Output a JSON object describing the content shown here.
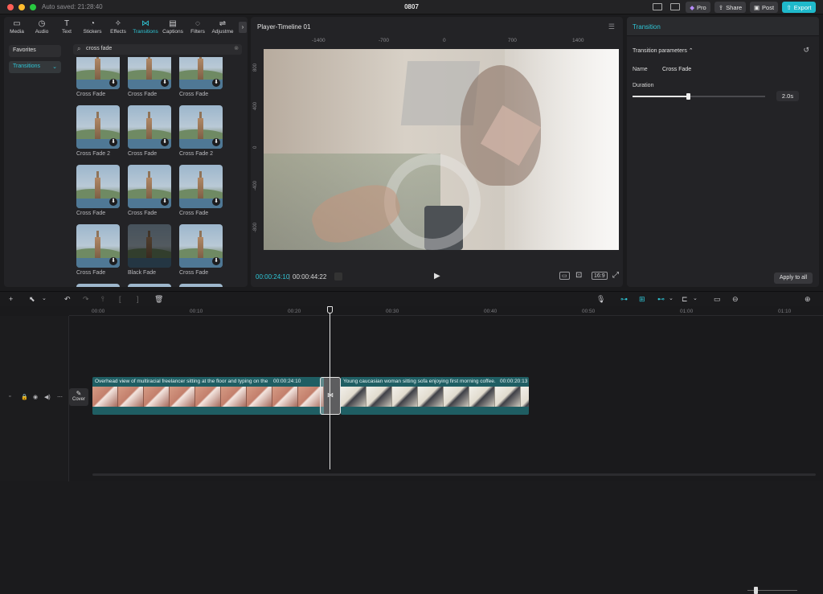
{
  "window": {
    "autosave": "Auto saved: 21:28:40",
    "title": "0807"
  },
  "topbar": {
    "pro": "Pro",
    "share": "Share",
    "post": "Post",
    "export": "Export"
  },
  "tabs": [
    {
      "label": "Media",
      "icon": "▭"
    },
    {
      "label": "Audio",
      "icon": "◷"
    },
    {
      "label": "Text",
      "icon": "T"
    },
    {
      "label": "Stickers",
      "icon": "◔"
    },
    {
      "label": "Effects",
      "icon": "✧"
    },
    {
      "label": "Transitions",
      "icon": "⋈"
    },
    {
      "label": "Captions",
      "icon": "▤"
    },
    {
      "label": "Filters",
      "icon": "◌"
    },
    {
      "label": "Adjustme",
      "icon": "⇌"
    }
  ],
  "sidebar": {
    "favorites": "Favorites",
    "transitions": "Transitions"
  },
  "search": {
    "value": "cross fade"
  },
  "grid": [
    {
      "name": "Cross Fade"
    },
    {
      "name": "Cross Fade"
    },
    {
      "name": "Cross Fade"
    },
    {
      "name": "Cross Fade 2"
    },
    {
      "name": "Cross Fade"
    },
    {
      "name": "Cross Fade 2"
    },
    {
      "name": "Cross Fade"
    },
    {
      "name": "Cross Fade"
    },
    {
      "name": "Cross Fade"
    },
    {
      "name": "Cross Fade"
    },
    {
      "name": "Black Fade"
    },
    {
      "name": "Cross Fade"
    }
  ],
  "player": {
    "title": "Player-Timeline 01",
    "ruler_h": [
      "-1400",
      "-700",
      "0",
      "700",
      "1400"
    ],
    "ruler_v": [
      "800",
      "400",
      "0",
      "-400",
      "-800"
    ],
    "time_current": "00:00:24:10",
    "time_total": "00:00:44:22",
    "aspect": "16:9"
  },
  "transition_panel": {
    "title": "Transition",
    "section": "Transition parameters",
    "name_label": "Name",
    "name_value": "Cross Fade",
    "duration_label": "Duration",
    "duration_value": "2.0s",
    "duration_level": 0.42,
    "apply_all": "Apply to all"
  },
  "timeline": {
    "ruler": [
      "00:00",
      "00:10",
      "00:20",
      "00:30",
      "00:40",
      "00:50",
      "01:00",
      "01:10"
    ],
    "cover": "Cover",
    "clips": [
      {
        "label": "Overhead view of multiracial freelancer sitting at the floor and typing on the",
        "time": "00:00:24:10"
      },
      {
        "label": "Young caucasian woman sitting sofa enjoying first morning coffee.",
        "time": "00:00:20:13"
      }
    ]
  }
}
